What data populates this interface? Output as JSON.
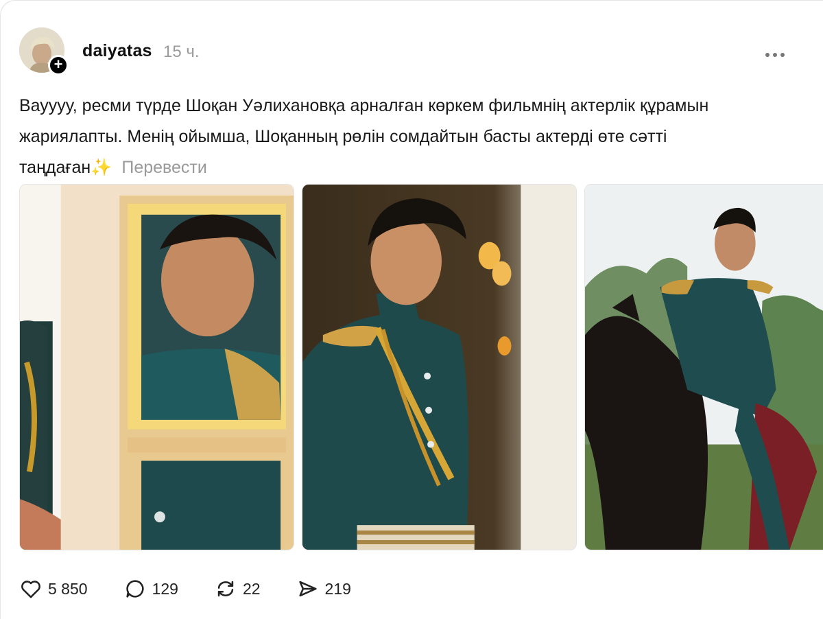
{
  "post": {
    "username": "daiyatas",
    "timestamp": "15 ч.",
    "text": "Вауууу, ресми түрде Шоқан Уәлихановқа арналған көркем фильмнің актерлік құрамын жариялапты. Менің ойымша, Шоқанның рөлін сомдайтын басты актерді өте сәтті таңдаған",
    "emoji": "✨",
    "translate_label": "Перевести"
  },
  "stats": {
    "likes": "5 850",
    "comments": "129",
    "reposts": "22",
    "shares": "219"
  },
  "icons": {
    "like": "heart-icon",
    "comment": "comment-bubble-icon",
    "repost": "repost-icon",
    "share": "send-icon",
    "more": "more-dots-icon",
    "follow": "plus-icon"
  },
  "colors": {
    "uniform_green": "#1f4f4f",
    "gold": "#c89a2c",
    "text_primary": "#1a1a1a",
    "text_secondary": "#9a9a9a"
  }
}
